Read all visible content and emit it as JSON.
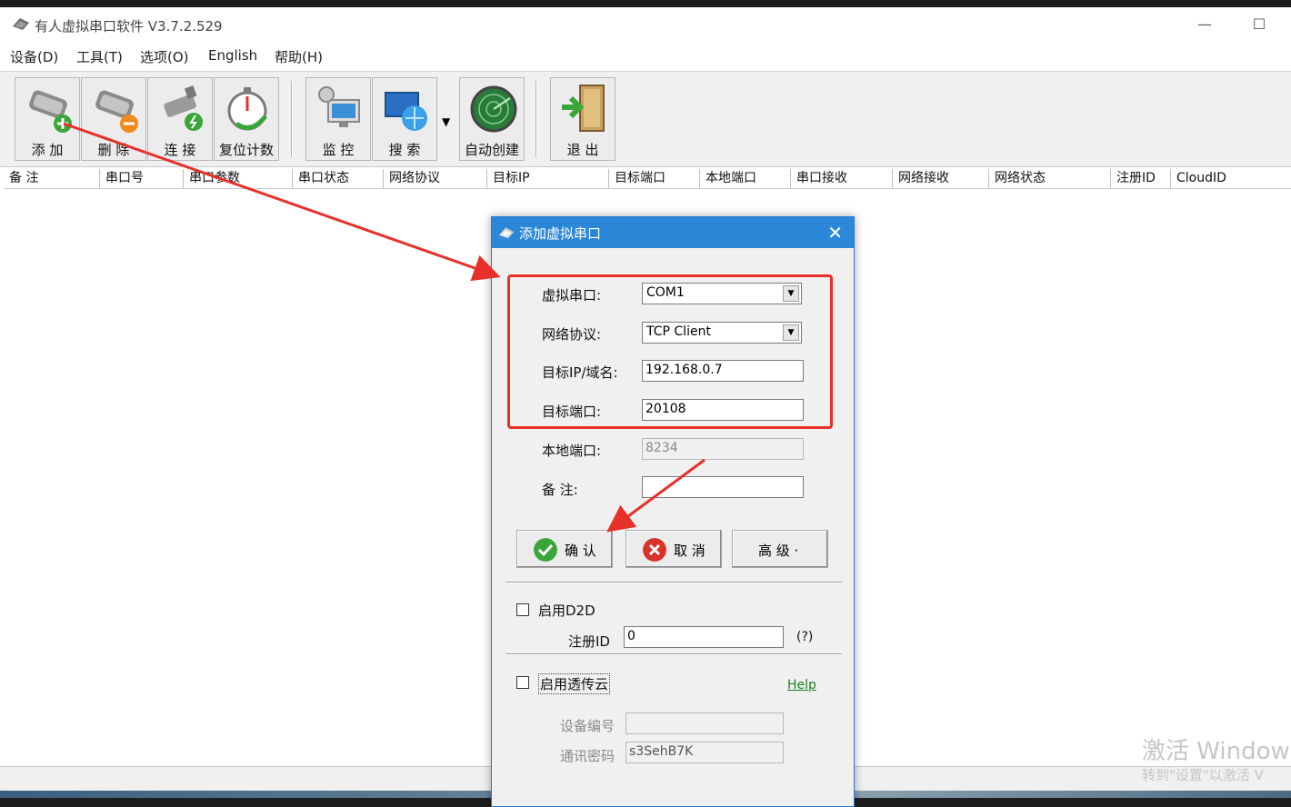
{
  "window": {
    "title": "有人虚拟串口软件 V3.7.2.529",
    "minimize": "—",
    "maximize": "☐"
  },
  "menu": [
    "设备(D)",
    "工具(T)",
    "选项(O)",
    "English",
    "帮助(H)"
  ],
  "toolbar": {
    "add": "添 加",
    "delete": "删 除",
    "connect": "连 接",
    "reset_count": "复位计数",
    "monitor": "监 控",
    "search": "搜 索",
    "auto_create": "自动创建",
    "exit": "退 出",
    "dropdown": "▼"
  },
  "columns": [
    "备 注",
    "串口号",
    "串口参数",
    "串口状态",
    "网络协议",
    "目标IP",
    "目标端口",
    "本地端口",
    "串口接收",
    "网络接收",
    "网络状态",
    "注册ID",
    "CloudID"
  ],
  "dialog": {
    "title": "添加虚拟串口",
    "close": "✕",
    "virtual_port_label": "虚拟串口:",
    "virtual_port_value": "COM1",
    "protocol_label": "网络协议:",
    "protocol_value": "TCP Client",
    "target_ip_label": "目标IP/域名:",
    "target_ip_value": "192.168.0.7",
    "target_port_label": "目标端口:",
    "target_port_value": "20108",
    "local_port_label": "本地端口:",
    "local_port_value": "8234",
    "note_label": "备 注:",
    "note_value": "",
    "confirm": "确 认",
    "cancel": "取 消",
    "advanced": "高 级 ·",
    "enable_d2d": "启用D2D",
    "register_id_label": "注册ID",
    "register_id_value": "0",
    "help_q": "(?)",
    "enable_cloud": "启用透传云",
    "help": "Help",
    "device_no_label": "设备编号",
    "device_no_value": "",
    "comm_pwd_label": "通讯密码",
    "comm_pwd_value": "s3SehB7K"
  },
  "watermark": {
    "line1": "激活 Window",
    "line2": "转到\"设置\"以激活 V"
  },
  "colors": {
    "dialog_title": "#2b88d8",
    "highlight_box": "#e8302a",
    "annotation_arrow": "#e8302a"
  }
}
